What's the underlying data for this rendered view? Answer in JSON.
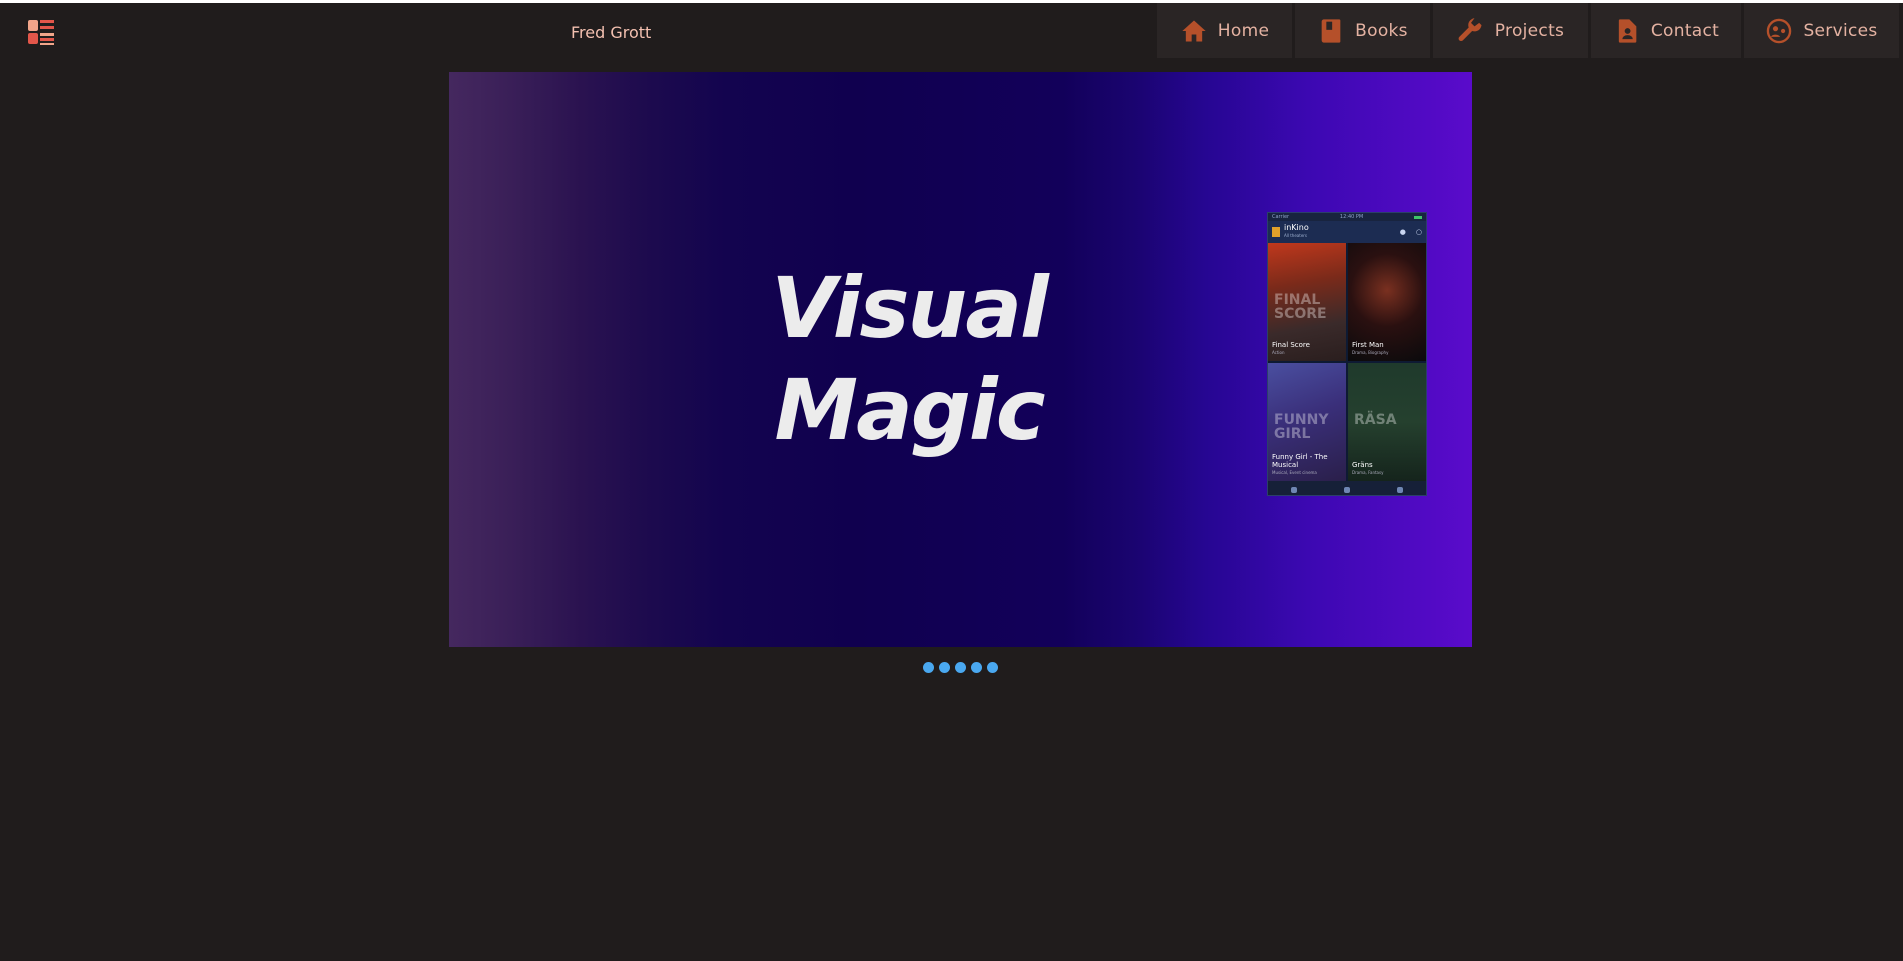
{
  "header": {
    "title": "Fred Grott",
    "menu_icon": "menu-icon"
  },
  "nav": {
    "items": [
      {
        "label": "Home",
        "icon": "home-icon"
      },
      {
        "label": "Books",
        "icon": "book-icon"
      },
      {
        "label": "Projects",
        "icon": "wrench-icon"
      },
      {
        "label": "Contact",
        "icon": "contact-icon"
      },
      {
        "label": "Services",
        "icon": "services-icon"
      }
    ]
  },
  "carousel": {
    "slide": {
      "title_line1": "Visual",
      "title_line2": "Magic"
    },
    "phone": {
      "app_name": "inKino",
      "app_sub": "All theaters",
      "status_left": "Carrier",
      "status_time": "12:40 PM",
      "movies": [
        {
          "title": "Final Score",
          "genre": "Action",
          "overlay": "FINAL SCORE"
        },
        {
          "title": "First Man",
          "genre": "Drama, Biography",
          "overlay": ""
        },
        {
          "title": "Funny Girl - The Musical",
          "genre": "Musical, Event cinema",
          "overlay": "FUNNY GIRL"
        },
        {
          "title": "Gräns",
          "genre": "Drama, Fantasy",
          "overlay": "RÄSA"
        }
      ]
    },
    "dot_count": 5
  },
  "colors": {
    "background": "#201c1c",
    "accent_icon": "#b5502a",
    "nav_text": "#e4b2a2",
    "dot": "#4aa8f0"
  }
}
